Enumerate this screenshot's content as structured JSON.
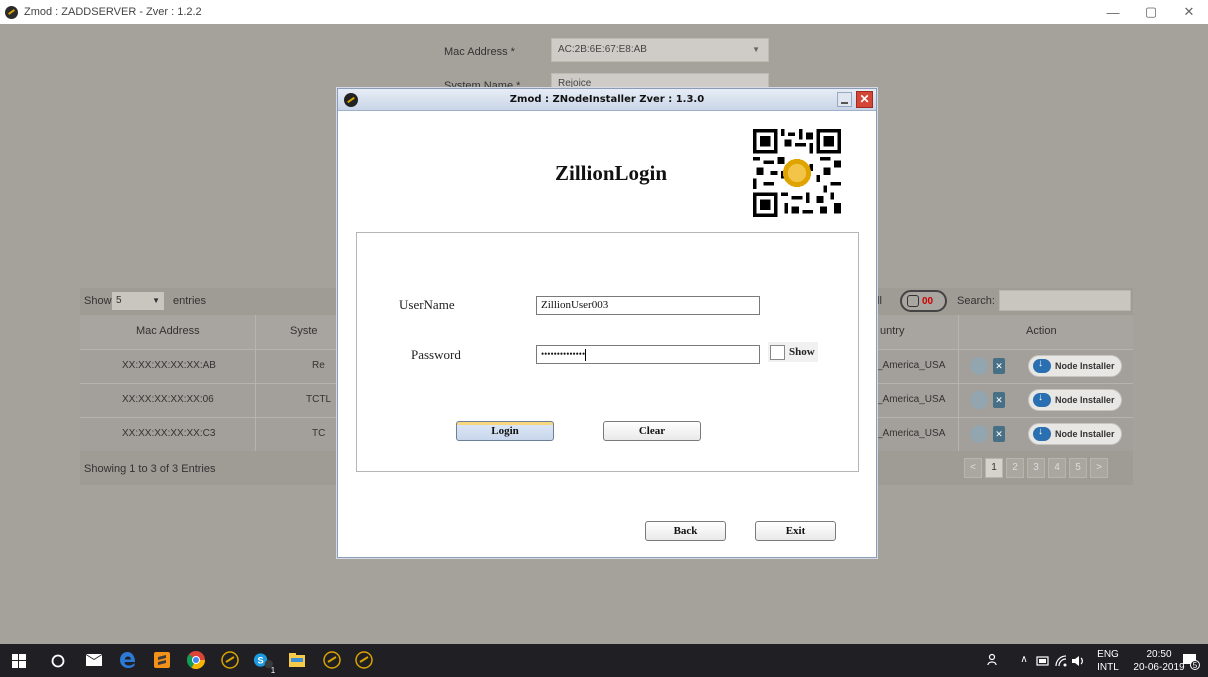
{
  "app": {
    "title": "Zmod : ZADDSERVER - Zver : 1.2.2",
    "min": "—",
    "max": "▢",
    "close": "✕"
  },
  "bg_form": {
    "mac_label": "Mac Address *",
    "mac_value": "AC:2B:6E:67:E8:AB",
    "system_label": "System Name *",
    "system_value": "Rejoice"
  },
  "table": {
    "show_label": "Show",
    "show_value": "5",
    "entries_label": "entries",
    "ll_label": "ll",
    "lock_count": "00",
    "search_label": "Search:",
    "headers": [
      "Mac Address",
      "Syste",
      "untry",
      "Action"
    ],
    "rows": [
      {
        "mac": "XX:XX:XX:XX:XX:AB",
        "system": "Re",
        "country": "_America_USA",
        "action": "Node Installer"
      },
      {
        "mac": "XX:XX:XX:XX:XX:06",
        "system": "TCTL",
        "country": "_America_USA",
        "action": "Node Installer"
      },
      {
        "mac": "XX:XX:XX:XX:XX:C3",
        "system": "TC",
        "country": "_America_USA",
        "action": "Node Installer"
      }
    ],
    "footer": "Showing 1 to 3 of 3 Entries",
    "pager": [
      "<",
      "1",
      "2",
      "3",
      "4",
      "5",
      ">"
    ]
  },
  "dialog": {
    "title": "Zmod : ZNodeInstaller Zver : 1.3.0",
    "close": "✕",
    "heading": "ZillionLogin",
    "username_label": "UserName",
    "username_value": "ZillionUser003",
    "password_label": "Password",
    "password_mask": "••••••••••••••",
    "show_label": "Show",
    "login_button": "Login",
    "clear_button": "Clear",
    "back_button": "Back",
    "exit_button": "Exit"
  },
  "taskbar": {
    "lang_top": "ENG",
    "lang_bottom": "INTL",
    "time": "20:50",
    "date": "20-06-2019",
    "notif_count": "5",
    "skype_badge": "1"
  },
  "colors": {
    "overlay_bg": "#a5a19b",
    "taskbar": "#1f1f24",
    "close_red": "#d54536",
    "edge_blue": "#2d7ad6"
  }
}
